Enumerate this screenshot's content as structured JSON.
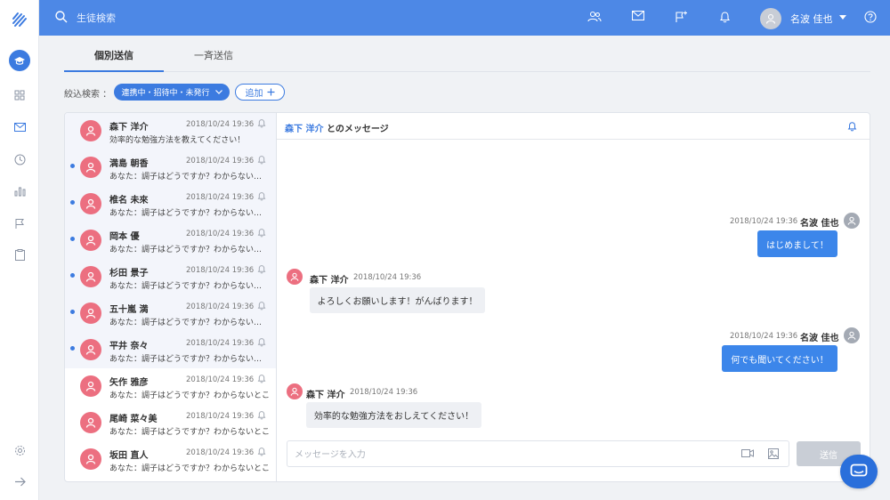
{
  "search": {
    "placeholder": "生徒検索"
  },
  "user": {
    "name": "名波 佳也"
  },
  "tabs": [
    {
      "label": "個別送信",
      "active": true
    },
    {
      "label": "一斉送信",
      "active": false
    }
  ],
  "filter": {
    "label": "絞込検索 ：",
    "chip": "連携中・招待中・未発行",
    "add_label": "追加"
  },
  "contacts": [
    {
      "name": "森下 洋介",
      "time": "2018/10/24 19:36",
      "preview": "効率的な勉強方法を教えてください！",
      "unread": false,
      "selected": true
    },
    {
      "name": "満島 朝香",
      "time": "2018/10/24 19:36",
      "preview": "あなた：調子はどうですか？わからないことがあったら",
      "unread": true,
      "selected": false
    },
    {
      "name": "椎名 未來",
      "time": "2018/10/24 19:36",
      "preview": "あなた：調子はどうですか？わからないことがあったら",
      "unread": true,
      "selected": false
    },
    {
      "name": "岡本 優",
      "time": "2018/10/24 19:36",
      "preview": "あなた：調子はどうですか？わからないことがあったら",
      "unread": true,
      "selected": false
    },
    {
      "name": "杉田 景子",
      "time": "2018/10/24 19:36",
      "preview": "あなた：調子はどうですか？わからないことがあったら",
      "unread": true,
      "selected": false
    },
    {
      "name": "五十嵐 満",
      "time": "2018/10/24 19:36",
      "preview": "あなた：調子はどうですか？わからないことがあったら",
      "unread": true,
      "selected": false
    },
    {
      "name": "平井 奈々",
      "time": "2018/10/24 19:36",
      "preview": "あなた：調子はどうですか？わからないことがあったら",
      "unread": true,
      "selected": false
    },
    {
      "name": "矢作 雅彦",
      "time": "2018/10/24 19:36",
      "preview": "あなた：調子はどうですか？わからないとこ",
      "unread": false,
      "selected": false
    },
    {
      "name": "尾崎 菜々美",
      "time": "2018/10/24 19:36",
      "preview": "あなた：調子はどうですか？わからないとこ",
      "unread": false,
      "selected": false
    },
    {
      "name": "坂田 直人",
      "time": "2018/10/24 19:36",
      "preview": "あなた：調子はどうですか？わからないとこ",
      "unread": false,
      "selected": false
    }
  ],
  "chat": {
    "partner": "森下 洋介",
    "title_suffix": "とのメッセージ",
    "messages": [
      {
        "sender": "名波 佳也",
        "time": "2018/10/24 19:36",
        "text": "はじめまして！",
        "outgoing": true
      },
      {
        "sender": "森下 洋介",
        "time": "2018/10/24 19:36",
        "text": "よろしくお願いします！がんばります！",
        "outgoing": false
      },
      {
        "sender": "名波 佳也",
        "time": "2018/10/24 19:36",
        "text": "何でも聞いてください！",
        "outgoing": true
      },
      {
        "sender": "森下 洋介",
        "time": "2018/10/24 19:36",
        "text": "効率的な勉強方法をおしえてください！",
        "outgoing": false
      }
    ],
    "input_placeholder": "メッセージを入力",
    "send_label": "送信"
  },
  "icons": [
    "logo-icon",
    "graduation-cap-icon",
    "dashboard-icon",
    "mail-icon",
    "clock-icon",
    "bar-chart-icon",
    "flag-icon",
    "clipboard-icon",
    "gear-icon",
    "arrow-right-icon",
    "search-icon",
    "users-icon",
    "flag-plus-icon",
    "bell-icon",
    "help-icon",
    "user-icon",
    "video-icon",
    "image-icon",
    "chat-bubble-icon"
  ],
  "colors": {
    "primary": "#4d88e6",
    "accent": "#3c7be0",
    "avatar": "#ec6f80",
    "send_disabled": "#c9ced6"
  }
}
